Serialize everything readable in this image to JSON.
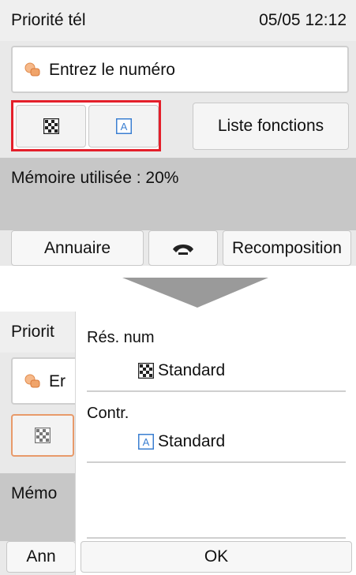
{
  "top_screen": {
    "status": {
      "title": "Priorité tél",
      "datetime": "05/05 12:12"
    },
    "number_field": {
      "placeholder": "Entrez le numéro",
      "icon": "hand-icon"
    },
    "icon_buttons": [
      {
        "icon": "resolution-icon"
      },
      {
        "icon": "contrast-icon",
        "glyph": "A"
      }
    ],
    "highlight_color": "#e41f2a",
    "list_button": "Liste fonctions",
    "memory": "Mémoire utilisée : 20%",
    "bottom_bar": {
      "directory": "Annuaire",
      "hook_icon": "phone-handset-icon",
      "redial": "Recomposition"
    }
  },
  "arrow_icon": "down-arrow-icon",
  "bottom_screen": {
    "background": {
      "status_title": "Priorit",
      "number_field": "Er",
      "memory": "Mémo",
      "directory": "Ann"
    },
    "panel": {
      "resolution": {
        "label": "Rés. num",
        "value": "Standard",
        "icon": "resolution-icon"
      },
      "contrast": {
        "label": "Contr.",
        "value": "Standard",
        "icon": "contrast-icon",
        "glyph": "A"
      },
      "ok": "OK"
    }
  }
}
